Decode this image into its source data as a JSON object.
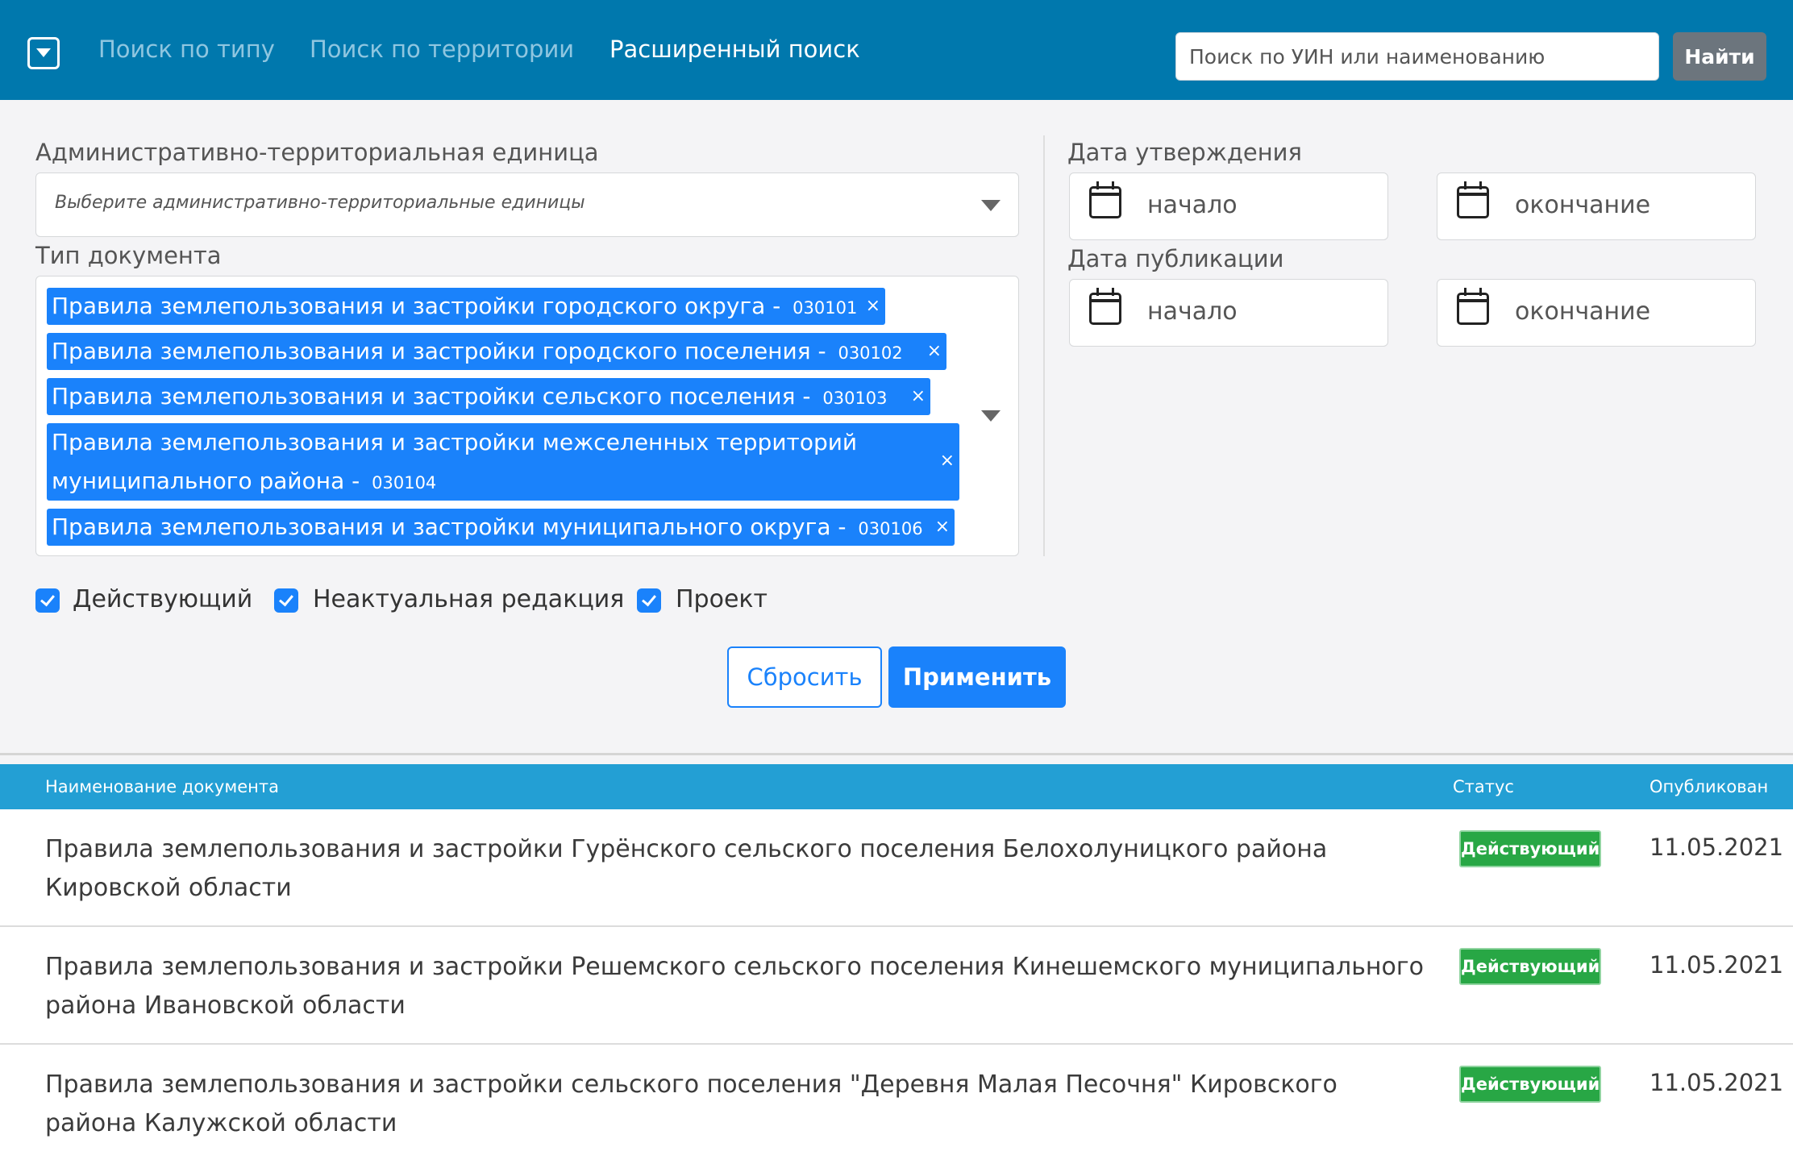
{
  "navbar": {
    "tabs": [
      {
        "label": "Поиск по типу",
        "active": false
      },
      {
        "label": "Поиск по территории",
        "active": false
      },
      {
        "label": "Расширенный поиск",
        "active": true
      }
    ],
    "search_placeholder": "Поиск по УИН или наименованию",
    "search_button": "Найти"
  },
  "filters": {
    "admin_unit": {
      "label": "Административно-территориальная единица",
      "placeholder": "Выберите административно-территориальные единицы"
    },
    "doc_type": {
      "label": "Тип документа",
      "selected": [
        {
          "name": "Правила землепользования и застройки городского округа - ",
          "code": "030101"
        },
        {
          "name": "Правила землепользования и застройки городского поселения - ",
          "code": "030102"
        },
        {
          "name": "Правила землепользования и застройки сельского поселения - ",
          "code": "030103"
        },
        {
          "name": "Правила землепользования и застройки межселенных территорий муниципального района - ",
          "code": "030104"
        },
        {
          "name": "Правила землепользования и застройки муниципального округа - ",
          "code": "030106"
        }
      ],
      "remove_glyph": "×"
    },
    "approval_date": {
      "label": "Дата утверждения",
      "start": "начало",
      "end": "окончание"
    },
    "publication_date": {
      "label": "Дата публикации",
      "start": "начало",
      "end": "окончание"
    },
    "statuses": [
      {
        "label": "Действующий",
        "checked": true
      },
      {
        "label": "Неактуальная редакция",
        "checked": true
      },
      {
        "label": "Проект",
        "checked": true
      }
    ],
    "reset_button": "Сбросить",
    "apply_button": "Применить"
  },
  "results": {
    "columns": [
      "Наименование документа",
      "Статус",
      "Опубликован"
    ],
    "rows": [
      {
        "title": "Правила землепользования и застройки Гурёнского сельского поселения Белохолуницкого района Кировской области",
        "status": "Действующий",
        "published": "11.05.2021"
      },
      {
        "title": "Правила землепользования и застройки Решемского сельского поселения Кинешемского муниципального района Ивановской области",
        "status": "Действующий",
        "published": "11.05.2021"
      },
      {
        "title": "Правила землепользования и застройки сельского поселения \"Деревня Малая Песочня\" Кировского района Калужской области",
        "status": "Действующий",
        "published": "11.05.2021"
      }
    ]
  },
  "colors": {
    "navbar": "#0078ad",
    "primary": "#1a82fb",
    "table_header": "#239fd4",
    "status_active": "#28a745"
  }
}
